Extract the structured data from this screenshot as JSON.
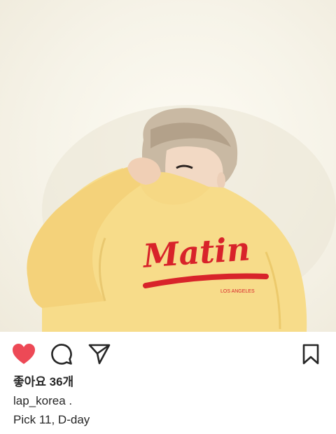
{
  "post": {
    "image_alt": "Person in a yellow sweatshirt pulling the collar over their face",
    "likes_text": "좋아요 36개",
    "username": "lap_korea",
    "username_suffix": " .",
    "caption": "Pick 11, D-day",
    "sweatshirt_print": "Matin",
    "sweatshirt_subtext": "LOS ANGELES"
  },
  "icons": {
    "like": "heart-filled-icon",
    "comment": "speech-bubble-icon",
    "share": "paper-plane-icon",
    "save": "bookmark-icon"
  },
  "colors": {
    "like_red": "#ed4956",
    "text": "#262626",
    "sweatshirt": "#f7dc8a",
    "print_red": "#d8232a"
  }
}
